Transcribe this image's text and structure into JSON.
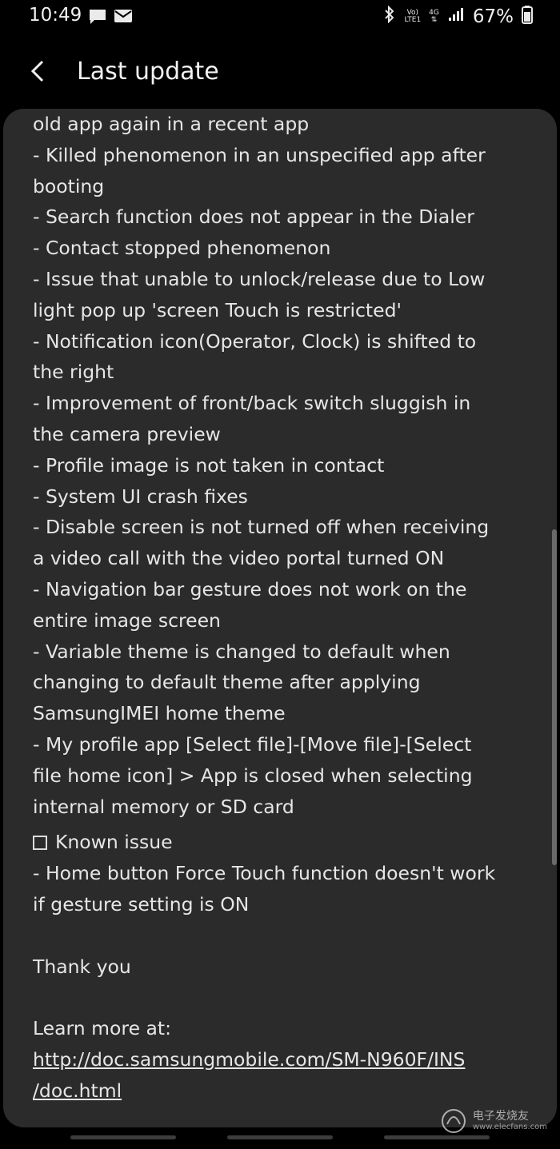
{
  "status_bar": {
    "time": "10:49",
    "left_icons": [
      "message-icon",
      "email-icon"
    ],
    "network_line1": "Vo)",
    "network_line2": "LTE1",
    "network_gen": "4G",
    "battery": "67%"
  },
  "app_bar": {
    "title": "Last update"
  },
  "content": {
    "lines": [
      "old app again in a recent app",
      " - Killed phenomenon in an unspecified app after",
      "booting",
      " - Search function does not appear in the Dialer",
      " - Contact stopped phenomenon",
      " - Issue that unable to unlock/release due to Low",
      "light pop up 'screen Touch is restricted'",
      " - Notification icon(Operator, Clock) is shifted to",
      "the right",
      " - Improvement of front/back switch sluggish in",
      "the camera preview",
      " - Profile image is not taken in contact",
      " - System UI crash fixes",
      " - Disable screen is not turned off when receiving",
      "a video call with the video portal turned ON",
      " - Navigation bar gesture does not work on the",
      "entire image screen",
      " - Variable theme is changed to default when",
      "changing to default theme after applying",
      "SamsungIMEI home theme",
      " - My profile app [Select file]-[Move file]-[Select",
      "file home icon] > App is closed when selecting",
      "internal memory or SD card"
    ],
    "known_issue_heading": "Known issue",
    "known_issue_lines": [
      " - Home button Force Touch function doesn't work",
      "if gesture setting is ON"
    ],
    "thanks": "Thank you",
    "learn_more": "Learn more at:",
    "link_line1": "http://doc.samsungmobile.com/SM-N960F/INS",
    "link_line2": "/doc.html"
  },
  "watermark": {
    "title": "电子发烧友",
    "url": "www.elecfans.com"
  }
}
